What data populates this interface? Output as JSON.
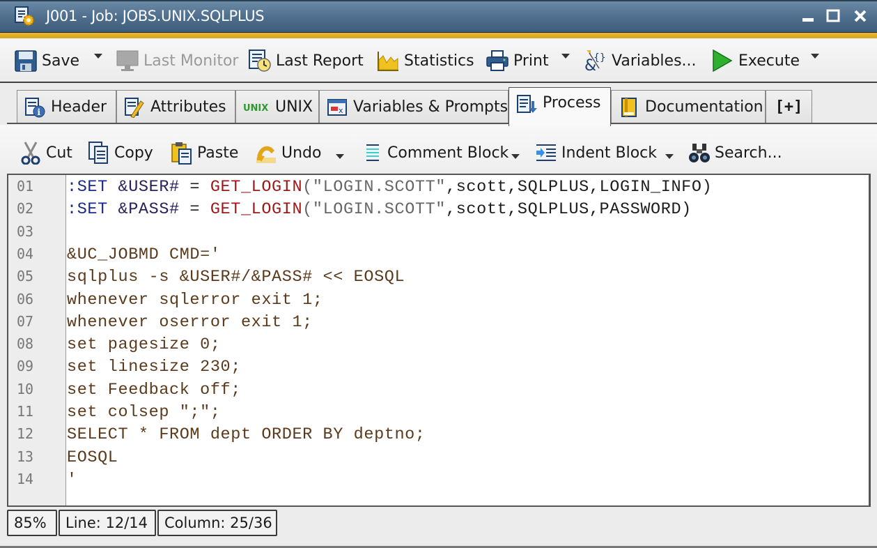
{
  "window": {
    "title": "J001 - Job: JOBS.UNIX.SQLPLUS",
    "app_icon": "job-settings-icon",
    "controls": {
      "minimize": "minimize-icon",
      "maximize": "maximize-icon",
      "close": "close-icon"
    }
  },
  "toolbar": {
    "save": "Save",
    "last_monitor": "Last Monitor",
    "last_report": "Last Report",
    "statistics": "Statistics",
    "print": "Print",
    "variables": "Variables...",
    "execute": "Execute"
  },
  "tabs": [
    {
      "label": "Header",
      "icon": "header-info-icon",
      "active": false
    },
    {
      "label": "Attributes",
      "icon": "attributes-icon",
      "active": false
    },
    {
      "label": "UNIX",
      "icon_text": "UNIX",
      "icon": "unix-icon",
      "active": false
    },
    {
      "label": "Variables & Prompts",
      "icon": "variables-prompts-icon",
      "active": false
    },
    {
      "label": "Process",
      "icon": "process-icon",
      "active": true
    },
    {
      "label": "Documentation",
      "icon": "documentation-icon",
      "active": false
    },
    {
      "label": "[+]",
      "icon": "add-tab-icon",
      "active": false
    }
  ],
  "edit_toolbar": {
    "cut": "Cut",
    "copy": "Copy",
    "paste": "Paste",
    "undo": "Undo",
    "comment_block": "Comment Block",
    "indent_block": "Indent Block",
    "search": "Search..."
  },
  "editor": {
    "line_numbers": [
      "01",
      "02",
      "03",
      "04",
      "05",
      "06",
      "07",
      "08",
      "09",
      "10",
      "11",
      "12",
      "13",
      "14"
    ],
    "lines": [
      [
        {
          "t": ":SET ",
          "c": "k-set"
        },
        {
          "t": "&USER#",
          "c": "k-var"
        },
        {
          "t": " = ",
          "c": "k-plain"
        },
        {
          "t": "GET_LOGIN",
          "c": "k-fn"
        },
        {
          "t": "(\"LOGIN.SCOTT\"",
          "c": "k-str"
        },
        {
          "t": ",scott,SQLPLUS,LOGIN_INFO)",
          "c": "k-plain"
        }
      ],
      [
        {
          "t": ":SET ",
          "c": "k-set"
        },
        {
          "t": "&PASS#",
          "c": "k-var"
        },
        {
          "t": " = ",
          "c": "k-plain"
        },
        {
          "t": "GET_LOGIN",
          "c": "k-fn"
        },
        {
          "t": "(\"LOGIN.SCOTT\"",
          "c": "k-str"
        },
        {
          "t": ",scott,SQLPLUS,PASSWORD)",
          "c": "k-plain"
        }
      ],
      [],
      [
        {
          "t": "&UC_JOBMD CMD='",
          "c": ""
        }
      ],
      [
        {
          "t": "sqlplus -s &USER#/&PASS# << EOSQL",
          "c": ""
        }
      ],
      [
        {
          "t": "whenever sqlerror exit 1;",
          "c": ""
        }
      ],
      [
        {
          "t": "whenever oserror exit 1;",
          "c": ""
        }
      ],
      [
        {
          "t": "set pagesize 0;",
          "c": ""
        }
      ],
      [
        {
          "t": "set linesize 230;",
          "c": ""
        }
      ],
      [
        {
          "t": "set Feedback off;",
          "c": ""
        }
      ],
      [
        {
          "t": "set colsep \";\";",
          "c": ""
        }
      ],
      [
        {
          "t": "SELECT * FROM dept ORDER BY deptno;",
          "c": ""
        }
      ],
      [
        {
          "t": "EOSQL",
          "c": ""
        }
      ],
      [
        {
          "t": "'",
          "c": ""
        }
      ]
    ]
  },
  "status": {
    "zoom": "85%",
    "line": "Line: 12/14",
    "column": "Column: 25/36"
  },
  "colors": {
    "titlebar": "#4f6f8e",
    "accent_gold": "#e0ae28",
    "keyword_set": "#1a2a8c",
    "function": "#9b1818",
    "code_text": "#5b3a1c"
  }
}
